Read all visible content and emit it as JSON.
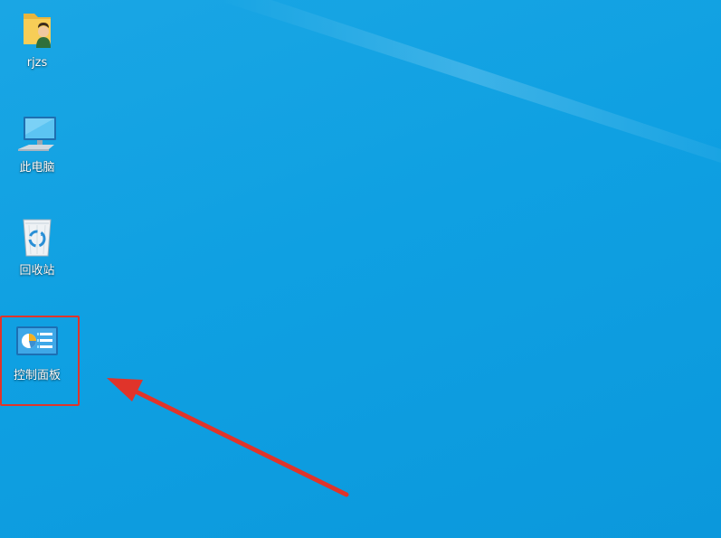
{
  "desktop": {
    "background_color": "#10a0e2",
    "icons": [
      {
        "label": "rjzs",
        "icon": "user-folder-icon"
      },
      {
        "label": "此电脑",
        "icon": "computer-monitor-icon"
      },
      {
        "label": "回收站",
        "icon": "recycle-bin-icon"
      },
      {
        "label": "控制面板",
        "icon": "control-panel-icon"
      }
    ]
  },
  "annotation": {
    "highlight_color": "#e0342a",
    "arrow_color": "#e0342a"
  }
}
